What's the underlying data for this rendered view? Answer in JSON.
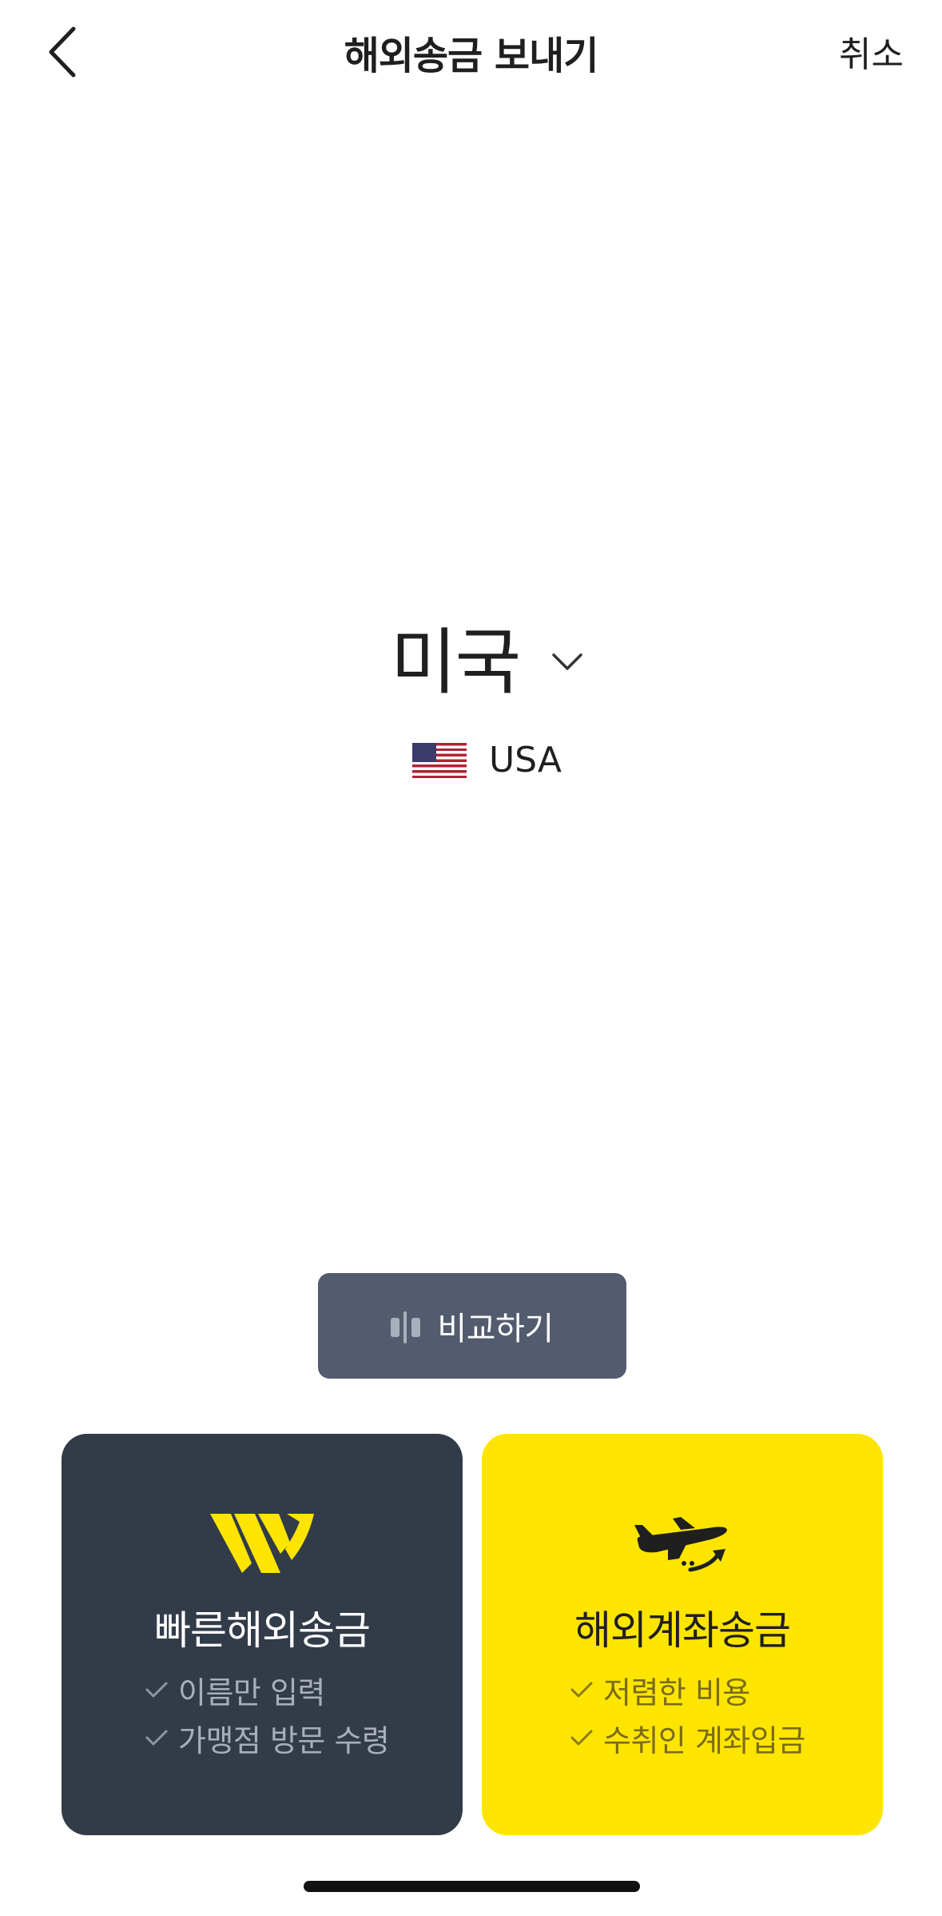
{
  "header": {
    "title": "해외송금 보내기",
    "cancel_label": "취소",
    "back_icon": "chevron-left-icon"
  },
  "country": {
    "name": "미국",
    "code": "USA",
    "flag_icon": "us-flag-icon",
    "dropdown_icon": "chevron-down-icon"
  },
  "compare": {
    "label": "비교하기",
    "icon": "compare-bars-icon"
  },
  "options": [
    {
      "title": "빠른해외송금",
      "icon": "w-logo-icon",
      "features": [
        "이름만 입력",
        "가맹점 방문 수령"
      ],
      "background": "#323b48"
    },
    {
      "title": "해외계좌송금",
      "icon": "airplane-icon",
      "features": [
        "저렴한 비용",
        "수취인 계좌입금"
      ],
      "background": "#fee500"
    }
  ],
  "colors": {
    "accent": "#fee500",
    "dark_card": "#323b48",
    "compare_button": "#535c6e"
  }
}
